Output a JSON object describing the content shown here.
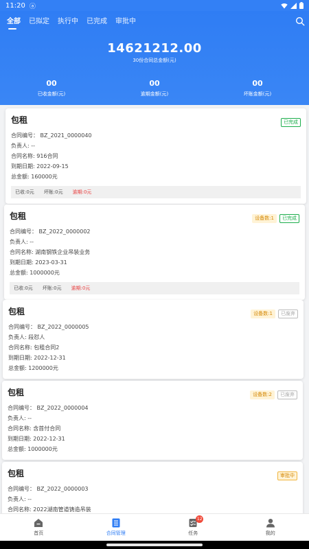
{
  "status_bar": {
    "time": "11:20",
    "notification_icon": "a-icon",
    "icons": [
      "wifi-icon",
      "signal-icon",
      "battery-icon"
    ]
  },
  "tabs": [
    {
      "label": "全部",
      "active": true
    },
    {
      "label": "已拟定",
      "active": false
    },
    {
      "label": "执行中",
      "active": false
    },
    {
      "label": "已完成",
      "active": false
    },
    {
      "label": "审批中",
      "active": false
    }
  ],
  "summary": {
    "total_amount": "14621212.00",
    "total_caption": "30份合同总金额(元)",
    "stats": [
      {
        "value": "00",
        "label": "已收金额(元)"
      },
      {
        "value": "00",
        "label": "逾期金额(元)"
      },
      {
        "value": "00",
        "label": "坏账金额(元)"
      }
    ]
  },
  "cards": [
    {
      "title": "包租",
      "badges": [
        {
          "text": "已完成",
          "style": "green"
        }
      ],
      "rows": [
        "合同编号： BZ_2021_0000040",
        "负责人: --",
        "合同名称: 916合同",
        "到期日期: 2022-09-15",
        "总金额: 160000元"
      ],
      "summary": {
        "received": "已收:0元",
        "bad": "坏账:0元",
        "overdue": "逾期:0元"
      }
    },
    {
      "title": "包租",
      "badges": [
        {
          "text": "设备数:1",
          "style": "orange-fill"
        },
        {
          "text": "已完成",
          "style": "green"
        }
      ],
      "rows": [
        "合同编号： BZ_2022_0000002",
        "负责人: --",
        "合同名称: 湖南钢铁企业吊装业务",
        "到期日期: 2023-03-31",
        "总金额: 1000000元"
      ],
      "summary": {
        "received": "已收:0元",
        "bad": "坏账:0元",
        "overdue": "逾期:0元"
      }
    },
    {
      "title": "包租",
      "badges": [
        {
          "text": "设备数:1",
          "style": "orange-fill"
        },
        {
          "text": "已废弃",
          "style": "gray"
        }
      ],
      "rows": [
        "合同编号： BZ_2022_0000005",
        "负责人: 段怼人",
        "合同名称: 包租合同2",
        "到期日期: 2022-12-31",
        "总金额: 1200000元"
      ]
    },
    {
      "title": "包租",
      "badges": [
        {
          "text": "设备数:2",
          "style": "orange-fill"
        },
        {
          "text": "已废弃",
          "style": "gray"
        }
      ],
      "rows": [
        "合同编号： BZ_2022_0000004",
        "负责人: --",
        "合同名称: 含首付合同",
        "到期日期: 2022-12-31",
        "总金额: 1000000元"
      ]
    },
    {
      "title": "包租",
      "badges": [
        {
          "text": "审批中",
          "style": "orange-outline"
        }
      ],
      "rows": [
        "合同编号： BZ_2022_0000003",
        "负责人: --",
        "合同名称: 2022湖南管道铸造吊装"
      ]
    }
  ],
  "bottom_nav": [
    {
      "label": "首页",
      "icon": "home-icon",
      "active": false
    },
    {
      "label": "合同管理",
      "icon": "contract-icon",
      "active": true
    },
    {
      "label": "任务",
      "icon": "task-icon",
      "active": false,
      "badge": "12"
    },
    {
      "label": "我的",
      "icon": "user-icon",
      "active": false
    }
  ],
  "colors": {
    "primary": "#2f7df4",
    "green": "#1aad4a",
    "orange": "#d48806",
    "red": "#e84141"
  }
}
